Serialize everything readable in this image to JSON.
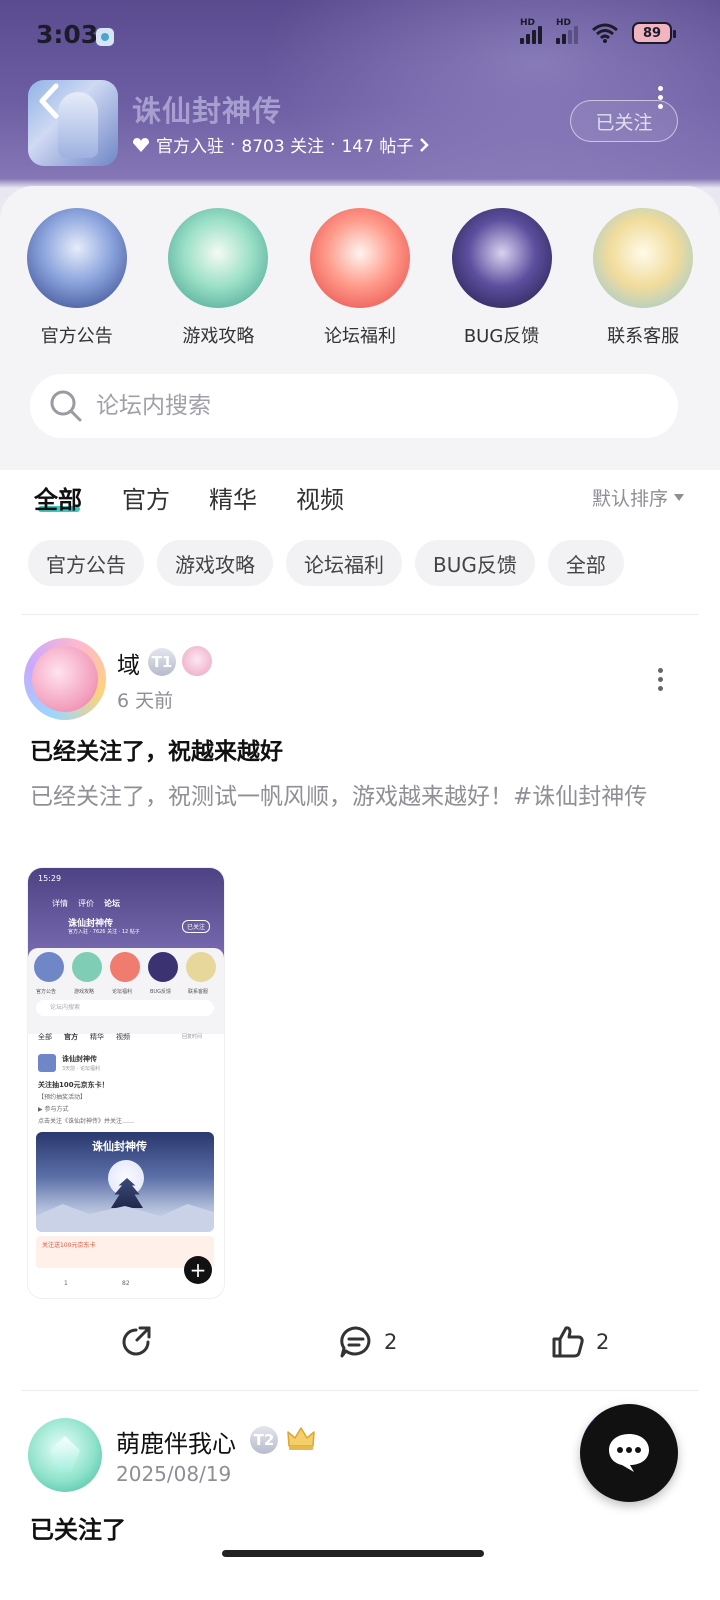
{
  "status_bar": {
    "time": "3:03",
    "signal1_label": "HD",
    "signal2_label": "HD",
    "battery": "89"
  },
  "forum": {
    "title": "诛仙封神传",
    "badge": "官方入驻",
    "followers": "8703 关注",
    "posts": "147 帖子",
    "separator": "·",
    "follow_label": "已关注"
  },
  "categories": [
    {
      "label": "官方公告"
    },
    {
      "label": "游戏攻略"
    },
    {
      "label": "论坛福利"
    },
    {
      "label": "BUG反馈"
    },
    {
      "label": "联系客服"
    }
  ],
  "search": {
    "placeholder": "论坛内搜索"
  },
  "tabs": [
    {
      "label": "全部",
      "active": true
    },
    {
      "label": "官方",
      "active": false
    },
    {
      "label": "精华",
      "active": false
    },
    {
      "label": "视频",
      "active": false
    }
  ],
  "sort_label": "默认排序",
  "chips": [
    "官方公告",
    "游戏攻略",
    "论坛福利",
    "BUG反馈",
    "全部"
  ],
  "post": {
    "author": "域",
    "badge": "T1",
    "time": "6 天前",
    "title": "已经关注了，祝越来越好",
    "body": "已经关注了，祝测试一帆风顺，游戏越来越好！#诛仙封神传",
    "thumbnail": {
      "status_time": "15:29",
      "tab_detail": "详情",
      "tab_review": "评价",
      "tab_forum": "论坛",
      "title": "诛仙封神传",
      "meta": "官方入驻 · 7626 关注 · 12 帖子",
      "follow": "已关注",
      "cats": [
        "官方公告",
        "游戏攻略",
        "论坛福利",
        "BUG反馈",
        "联系客服"
      ],
      "search": "论坛内搜索",
      "tabs": [
        "全部",
        "官方",
        "精华",
        "视频"
      ],
      "sort": "回复时间",
      "post_author": "诛仙封神传",
      "post_tag": "3天前 · 论坛福利",
      "post_title": "关注抽100元京东卡！",
      "line1": "【预约抽奖活动】",
      "line2": "▶ 参与方式",
      "line3": "点击关注《诛仙封神传》并关注……",
      "img_title": "诛仙封神传",
      "promo": "关注送100元京东卡",
      "stat_share": "1",
      "stat_comment": "82"
    },
    "comments": "2",
    "likes": "2"
  },
  "post2": {
    "author": "萌鹿伴我心",
    "badge": "T2",
    "time": "2025/08/19",
    "title": "已关注了"
  },
  "colors": {
    "accent": "#3dc7c1",
    "header": "#5a4b8f"
  }
}
